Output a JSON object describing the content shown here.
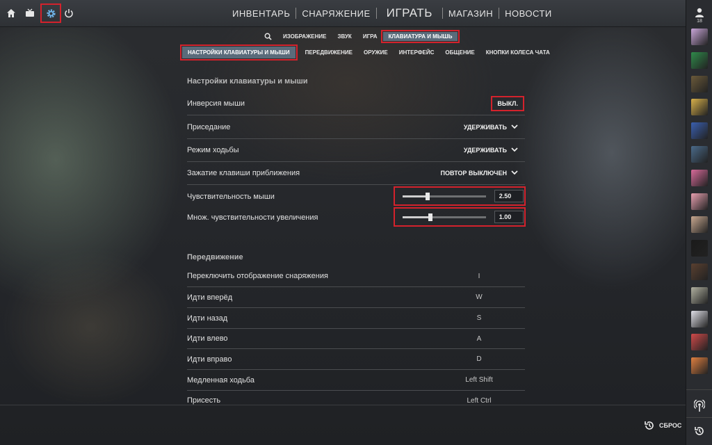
{
  "topbar": {
    "icons": [
      "home-icon",
      "tv-icon",
      "gear-icon",
      "power-icon"
    ],
    "nav": [
      {
        "label": "ИНВЕНТАРЬ"
      },
      {
        "label": "СНАРЯЖЕНИЕ"
      },
      {
        "label": "ИГРАТЬ"
      },
      {
        "label": "МАГАЗИН"
      },
      {
        "label": "НОВОСТИ"
      }
    ]
  },
  "subnav": {
    "items": [
      "ИЗОБРАЖЕНИЕ",
      "ЗВУК",
      "ИГРА",
      "КЛАВИАТУРА И МЫШЬ"
    ],
    "active": "КЛАВИАТУРА И МЫШЬ"
  },
  "subnav2": {
    "items": [
      "НАСТРОЙКИ КЛАВИАТУРЫ И МЫШИ",
      "ПЕРЕДВИЖЕНИЕ",
      "ОРУЖИЕ",
      "ИНТЕРФЕЙС",
      "ОБЩЕНИЕ",
      "КНОПКИ КОЛЕСА ЧАТА"
    ],
    "active": "НАСТРОЙКИ КЛАВИАТУРЫ И МЫШИ"
  },
  "section1": {
    "title": "Настройки клавиатуры и мыши",
    "rows": [
      {
        "label": "Инверсия мыши",
        "value": "ВЫКЛ."
      },
      {
        "label": "Приседание",
        "value": "УДЕРЖИВАТЬ"
      },
      {
        "label": "Режим ходьбы",
        "value": "УДЕРЖИВАТЬ"
      },
      {
        "label": "Зажатие клавиши приближения",
        "value": "ПОВТОР ВЫКЛЮЧЕН"
      }
    ],
    "sliders": [
      {
        "label": "Чувствительность мыши",
        "value": "2.50",
        "fraction": 0.3
      },
      {
        "label": "Множ. чувствительности увеличения",
        "value": "1.00",
        "fraction": 0.33
      }
    ]
  },
  "section2": {
    "title": "Передвижение",
    "rows": [
      {
        "label": "Переключить отображение снаряжения",
        "key": "I"
      },
      {
        "label": "Идти вперёд",
        "key": "W"
      },
      {
        "label": "Идти назад",
        "key": "S"
      },
      {
        "label": "Идти влево",
        "key": "A"
      },
      {
        "label": "Идти вправо",
        "key": "D"
      },
      {
        "label": "Медленная ходьба",
        "key": "Left Shift"
      },
      {
        "label": "Присесть",
        "key": "Left Ctrl"
      }
    ]
  },
  "rightbar": {
    "friends_count": "18",
    "avatar_colors": [
      "#c9a6d9",
      "#2f8a4a",
      "#6b5a3a",
      "#d8b04a",
      "#3a5fb0",
      "#4a6a8a",
      "#d86a9a",
      "#e8a0b0",
      "#c8a890",
      "#1a1a1a",
      "#5a4030",
      "#b0b0a0",
      "#e0e0e8",
      "#d04a4a",
      "#e08040"
    ]
  },
  "footer": {
    "reset_label": "СБРОС"
  },
  "colors": {
    "accent_highlight": "#d4222c",
    "active_tab": "#5a6b7a"
  }
}
